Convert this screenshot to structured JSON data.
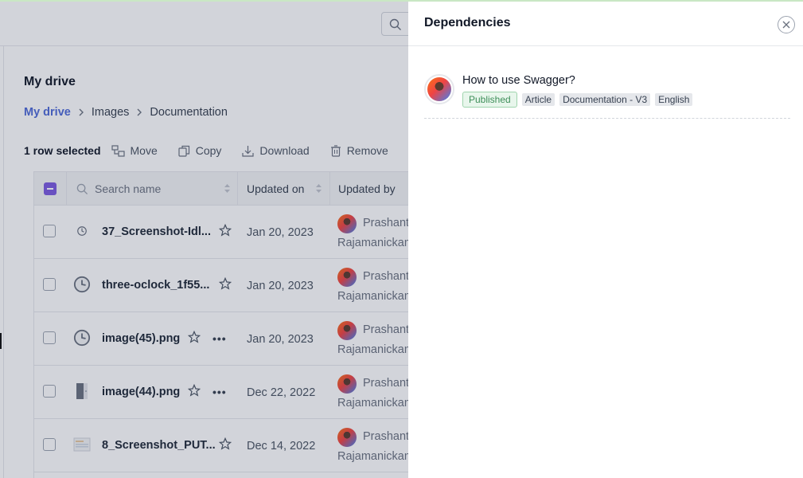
{
  "drive": {
    "title": "My drive",
    "breadcrumb": [
      "My drive",
      "Images",
      "Documentation"
    ]
  },
  "toolbar": {
    "selection": "1 row selected",
    "move": "Move",
    "copy": "Copy",
    "download": "Download",
    "remove": "Remove"
  },
  "table": {
    "search_placeholder": "Search name",
    "col_updated_on": "Updated on",
    "col_updated_by": "Updated by",
    "rows": [
      {
        "name": "37_Screenshot-Idl...",
        "date": "Jan 20, 2023",
        "user_first": "Prashant",
        "user_last": "Rajamanickam",
        "icon": "clock-icon"
      },
      {
        "name": "three-oclock_1f55...",
        "date": "Jan 20, 2023",
        "user_first": "Prashant",
        "user_last": "Rajamanickam",
        "icon": "clock-icon"
      },
      {
        "name": "image(45).png",
        "date": "Jan 20, 2023",
        "user_first": "Prashant",
        "user_last": "Rajamanickam",
        "icon": "clock-icon"
      },
      {
        "name": "image(44).png",
        "date": "Dec 22, 2022",
        "user_first": "Prashant",
        "user_last": "Rajamanickam",
        "icon": "image-thumb-icon"
      },
      {
        "name": "8_Screenshot_PUT...",
        "date": "Dec 14, 2022",
        "user_first": "Prashant",
        "user_last": "Rajamanickam",
        "icon": "image-thumb-icon"
      }
    ]
  },
  "panel": {
    "title": "Dependencies",
    "item": {
      "title": "How to use Swagger?",
      "status": "Published",
      "tags": [
        "Article",
        "Documentation - V3",
        "English"
      ]
    }
  },
  "colors": {
    "accent": "#4f6bd8",
    "checkbox": "#7c5ce0",
    "published_bg": "#e8f6ec",
    "published_text": "#3f8f5a"
  }
}
